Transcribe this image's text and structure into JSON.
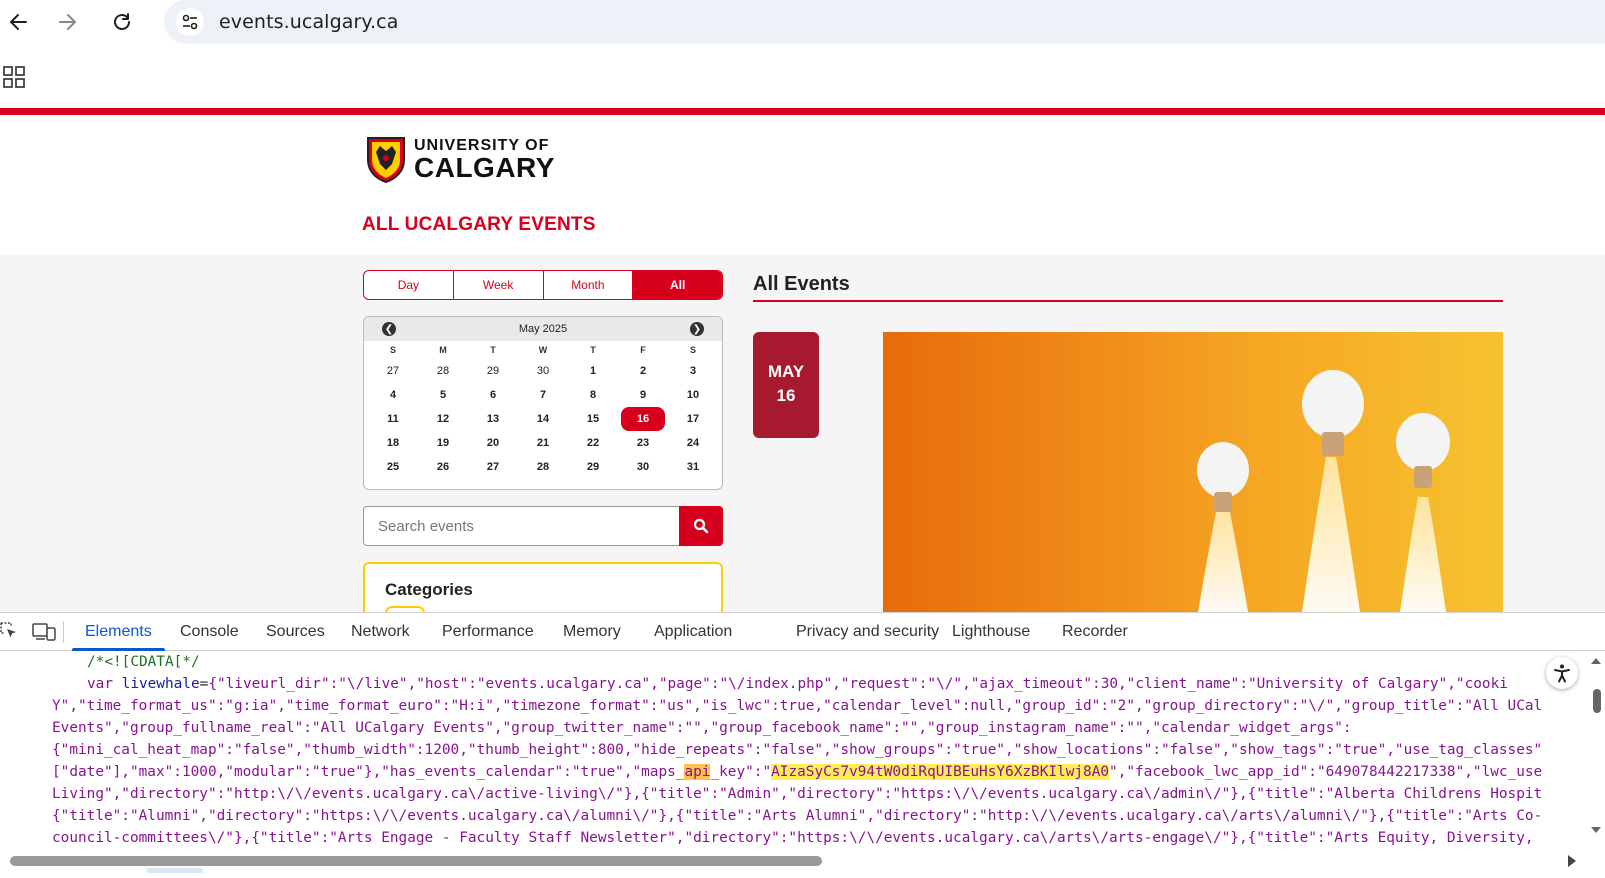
{
  "browser": {
    "url": "events.ucalgary.ca"
  },
  "site": {
    "logo_line1": "UNIVERSITY OF",
    "logo_line2": "CALGARY",
    "title": "ALL UCALGARY EVENTS"
  },
  "view_tabs": [
    {
      "label": "Day",
      "active": false
    },
    {
      "label": "Week",
      "active": false
    },
    {
      "label": "Month",
      "active": false
    },
    {
      "label": "All",
      "active": true
    }
  ],
  "mini_calendar": {
    "month_label": "May 2025",
    "days_of_week": [
      "S",
      "M",
      "T",
      "W",
      "T",
      "F",
      "S"
    ],
    "weeks": [
      [
        "27",
        "28",
        "29",
        "30",
        "1",
        "2",
        "3"
      ],
      [
        "4",
        "5",
        "6",
        "7",
        "8",
        "9",
        "10"
      ],
      [
        "11",
        "12",
        "13",
        "14",
        "15",
        "16",
        "17"
      ],
      [
        "18",
        "19",
        "20",
        "21",
        "22",
        "23",
        "24"
      ],
      [
        "25",
        "26",
        "27",
        "28",
        "29",
        "30",
        "31"
      ]
    ],
    "selected_day": "16"
  },
  "search": {
    "placeholder": "Search events"
  },
  "categories": {
    "title": "Categories"
  },
  "events": {
    "heading": "All Events",
    "first_event": {
      "month": "MAY",
      "day": "16"
    }
  },
  "devtools": {
    "tabs": [
      "Elements",
      "Console",
      "Sources",
      "Network",
      "Performance",
      "Memory",
      "Application",
      "Privacy and security",
      "Lighthouse",
      "Recorder"
    ],
    "active_tab": "Elements",
    "code_lines": [
      "/*<![CDATA[*/",
      "var livewhale={\"liveurl_dir\":\"\\/live\",\"host\":\"events.ucalgary.ca\",\"page\":\"\\/index.php\",\"request\":\"\\/\",\"ajax_timeout\":30,\"client_name\":\"University of Calgary\",\"cooki",
      "Y\",\"time_format_us\":\"g:ia\",\"time_format_euro\":\"H:i\",\"timezone_format\":\"us\",\"is_lwc\":true,\"calendar_level\":null,\"group_id\":\"2\",\"group_directory\":\"\\/\",\"group_title\":\"All UCal",
      "Events\",\"group_fullname_real\":\"All UCalgary Events\",\"group_twitter_name\":\"\",\"group_facebook_name\":\"\",\"group_instagram_name\":\"\",\"calendar_widget_args\":",
      "{\"mini_cal_heat_map\":\"false\",\"thumb_width\":1200,\"thumb_height\":800,\"hide_repeats\":\"false\",\"show_groups\":\"true\",\"show_locations\":\"false\",\"show_tags\":\"true\",\"use_tag_classes\"",
      "[\"date\"],\"max\":1000,\"modular\":\"true\"},\"has_events_calendar\":\"true\",\"maps_api_key\":\"AIzaSyCs7v94tW0diRqUIBEuHsY6XzBKIlwj8A0\",\"facebook_lwc_app_id\":\"649078442217338\",\"lwc_use",
      "Living\",\"directory\":\"http:\\/\\/events.ucalgary.ca\\/active-living\\/\"},{\"title\":\"Admin\",\"directory\":\"https:\\/\\/events.ucalgary.ca\\/admin\\/\"},{\"title\":\"Alberta Childrens Hospit",
      "{\"title\":\"Alumni\",\"directory\":\"https:\\/\\/events.ucalgary.ca\\/alumni\\/\"},{\"title\":\"Arts Alumni\",\"directory\":\"http:\\/\\/events.ucalgary.ca\\/arts\\/alumni\\/\"},{\"title\":\"Arts Co-",
      "council-committees\\/\"},{\"title\":\"Arts Engage - Faculty Staff Newsletter\",\"directory\":\"https:\\/\\/events.ucalgary.ca\\/arts\\/arts-engage\\/\"},{\"title\":\"Arts Equity, Diversity,"
    ],
    "highlight_word": "api",
    "highlight_key": "AIzaSyCs7v94tW0diRqUIBEuHsY6XzBKIlwj8A0"
  },
  "colors": {
    "brand_red": "#d6001c",
    "badge_red": "#a6192e",
    "brand_gold": "#ffcd00",
    "devtools_blue": "#0b57d0"
  }
}
